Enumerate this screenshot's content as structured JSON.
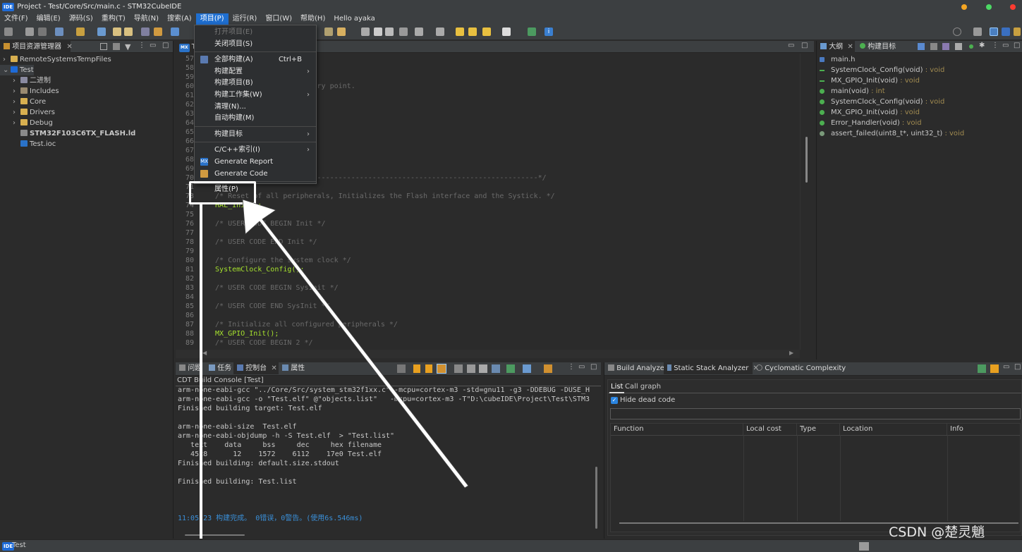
{
  "window": {
    "title": "Project - Test/Core/Src/main.c - STM32CubeIDE",
    "logo": "IDE"
  },
  "menubar": {
    "items": [
      "文件(F)",
      "编辑(E)",
      "源码(S)",
      "重构(T)",
      "导航(N)",
      "搜索(A)",
      "项目(P)",
      "运行(R)",
      "窗口(W)",
      "帮助(H)",
      "Hello ayaka"
    ],
    "active_index": 6
  },
  "project_explorer": {
    "tab_label": "项目资源管理器",
    "items": [
      {
        "label": "RemoteSystemsTempFiles",
        "icon": "folder-icon",
        "indent": 1,
        "expander": "›"
      },
      {
        "label": "Test",
        "icon": "ide-project-icon",
        "indent": 1,
        "expander": "⌄"
      },
      {
        "label": "二进制",
        "icon": "binaries-icon",
        "indent": 2,
        "expander": "›"
      },
      {
        "label": "Includes",
        "icon": "includes-icon",
        "indent": 2,
        "expander": "›"
      },
      {
        "label": "Core",
        "icon": "folder-icon",
        "indent": 2,
        "expander": "›"
      },
      {
        "label": "Drivers",
        "icon": "folder-icon",
        "indent": 2,
        "expander": "›"
      },
      {
        "label": "Debug",
        "icon": "folder-icon",
        "indent": 2,
        "expander": "›"
      },
      {
        "label": "STM32F103C6TX_FLASH.ld",
        "icon": "file-icon",
        "indent": 2,
        "expander": "",
        "bold": true
      },
      {
        "label": "Test.ioc",
        "icon": "mx-file-icon",
        "indent": 2,
        "expander": ""
      }
    ]
  },
  "editor": {
    "tab_label": "Te",
    "lines": [
      {
        "n": "57",
        "text": "",
        "cls": "cn"
      },
      {
        "n": "58",
        "text": "",
        "cls": "cn"
      },
      {
        "n": "59",
        "text": "",
        "cls": "cn"
      },
      {
        "n": "60",
        "text": "                       entry point.",
        "cls": "cm"
      },
      {
        "n": "61",
        "text": "",
        "cls": "cn"
      },
      {
        "n": "62",
        "text": "",
        "cls": "cn"
      },
      {
        "n": "63",
        "text": "",
        "cls": "cn"
      },
      {
        "n": "64",
        "text": "",
        "cls": "cn"
      },
      {
        "n": "65",
        "text": "",
        "cls": "cn"
      },
      {
        "n": "66",
        "text": "",
        "cls": "cn"
      },
      {
        "n": "67",
        "text": "",
        "cls": "cn"
      },
      {
        "n": "68",
        "text": "",
        "cls": "cn"
      },
      {
        "n": "69",
        "text": "",
        "cls": "cn"
      },
      {
        "n": "70",
        "text": "  /* MCU Configuration--------------------------------------------------------*/",
        "cls": "cm"
      },
      {
        "n": "71",
        "text": "",
        "cls": "cn"
      },
      {
        "n": "73",
        "text": "  /* Reset of all peripherals, Initializes the Flash interface and the Systick. */",
        "cls": "cm"
      },
      {
        "n": "74",
        "text": "  HAL_Init();",
        "cls": "fn"
      },
      {
        "n": "75",
        "text": "",
        "cls": "cn"
      },
      {
        "n": "76",
        "text": "  /* USER CODE BEGIN Init */",
        "cls": "cm"
      },
      {
        "n": "77",
        "text": "",
        "cls": "cn"
      },
      {
        "n": "78",
        "text": "  /* USER CODE END Init */",
        "cls": "cm"
      },
      {
        "n": "79",
        "text": "",
        "cls": "cn"
      },
      {
        "n": "80",
        "text": "  /* Configure the system clock */",
        "cls": "cm"
      },
      {
        "n": "81",
        "text": "  SystemClock_Config();",
        "cls": "fn"
      },
      {
        "n": "82",
        "text": "",
        "cls": "cn"
      },
      {
        "n": "83",
        "text": "  /* USER CODE BEGIN SysInit */",
        "cls": "cm"
      },
      {
        "n": "84",
        "text": "",
        "cls": "cn"
      },
      {
        "n": "85",
        "text": "  /* USER CODE END SysInit */",
        "cls": "cm"
      },
      {
        "n": "86",
        "text": "",
        "cls": "cn"
      },
      {
        "n": "87",
        "text": "  /* Initialize all configured peripherals */",
        "cls": "cm"
      },
      {
        "n": "88",
        "text": "  MX_GPIO_Init();",
        "cls": "fn"
      },
      {
        "n": "89",
        "text": "  /* USER CODE BEGIN 2 */",
        "cls": "cm"
      }
    ]
  },
  "outline": {
    "tabs": [
      "大纲",
      "构建目标"
    ],
    "items": [
      {
        "name": "main.h",
        "ret": "",
        "icon": "header-file-icon"
      },
      {
        "name": "SystemClock_Config(void)",
        "ret": " : void",
        "icon": "function-declaration-icon"
      },
      {
        "name": "MX_GPIO_Init(void)",
        "ret": " : void",
        "icon": "static-function-declaration-icon"
      },
      {
        "name": "main(void)",
        "ret": " : int",
        "icon": "function-icon"
      },
      {
        "name": "SystemClock_Config(void)",
        "ret": " : void",
        "icon": "function-icon"
      },
      {
        "name": "MX_GPIO_Init(void)",
        "ret": " : void",
        "icon": "static-function-icon"
      },
      {
        "name": "Error_Handler(void)",
        "ret": " : void",
        "icon": "function-icon"
      },
      {
        "name": "assert_failed(uint8_t*, uint32_t)",
        "ret": " : void",
        "icon": "inactive-function-icon"
      }
    ]
  },
  "context_menu": {
    "items": [
      {
        "label": "打开项目(E)",
        "disabled": true
      },
      {
        "label": "关闭项目(S)"
      },
      {
        "sep": true
      },
      {
        "label": "全部构建(A)",
        "shortcut": "Ctrl+B",
        "icon": "build-all-icon"
      },
      {
        "label": "构建配置",
        "submenu": true
      },
      {
        "label": "构建项目(B)"
      },
      {
        "label": "构建工作集(W)",
        "submenu": true
      },
      {
        "label": "清理(N)..."
      },
      {
        "label": "自动构建(M)"
      },
      {
        "sep": true
      },
      {
        "label": "构建目标",
        "submenu": true
      },
      {
        "sep": true
      },
      {
        "label": "C/C++索引(I)",
        "submenu": true
      },
      {
        "label": "Generate Report",
        "icon": "mx-icon"
      },
      {
        "label": "Generate Code",
        "icon": "generate-code-icon"
      },
      {
        "sep": true
      },
      {
        "label": "属性(P)"
      }
    ]
  },
  "console": {
    "tabs": [
      "问题",
      "任务",
      "控制台",
      "属性"
    ],
    "title": "CDT Build Console [Test]",
    "lines": [
      "arm-none-eabi-gcc \"../Core/Src/system_stm32f1xx.c\" -mcpu=cortex-m3 -std=gnu11 -g3 -DDEBUG -DUSE_H",
      "arm-none-eabi-gcc -o \"Test.elf\" @\"objects.list\"   -mcpu=cortex-m3 -T\"D:\\cubeIDE\\Project\\Test\\STM3",
      "Finished building target: Test.elf",
      "",
      "arm-none-eabi-size  Test.elf",
      "arm-none-eabi-objdump -h -S Test.elf  > \"Test.list\"",
      "   text    data     bss     dec     hex filename",
      "   4528      12    1572    6112    17e0 Test.elf",
      "Finished building: default.size.stdout",
      "",
      "Finished building: Test.list",
      "",
      "",
      ""
    ],
    "status_line": "11:05:23 构建完成。 0错误，0警告。(使用6s.546ms)"
  },
  "analyzer": {
    "tabs": [
      "Build Analyzer",
      "Static Stack Analyzer",
      "Cyclomatic Complexity"
    ],
    "subtabs": [
      "List",
      "Call graph"
    ],
    "hide_dead_code": "Hide dead code",
    "columns": [
      "Function",
      "Local cost",
      "Type",
      "Location",
      "Info"
    ]
  },
  "statusbar": {
    "project": "Test"
  },
  "watermark": "CSDN @楚灵魈",
  "colors": {
    "accent": "#1f6fd0",
    "function": "#a6e22e",
    "comment": "#6a6a6a",
    "return_type": "#a08a50",
    "console_status": "#3a8fd8"
  }
}
